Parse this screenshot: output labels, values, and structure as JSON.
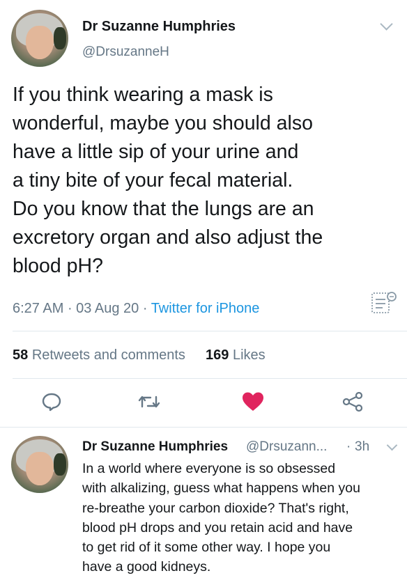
{
  "tweet": {
    "author_name": "Dr Suzanne Humphries",
    "author_handle": "@DrsuzanneH",
    "text": "If you think wearing a mask is\nwonderful, maybe you should also\nhave a little sip of your urine and\na tiny bite of your fecal material.\nDo you know that the lungs are an\nexcretory organ and also adjust the\nblood pH?",
    "time": "6:27 AM",
    "date": "03 Aug 20",
    "source": "Twitter for iPhone",
    "retweets_count": "58",
    "retweets_label": "Retweets and comments",
    "likes_count": "169",
    "likes_label": "Likes",
    "liked": true
  },
  "reply": {
    "author_name": "Dr Suzanne Humphries",
    "author_handle": "@Drsuzann...",
    "age": "3h",
    "text": "In a world where everyone is so obsessed\nwith alkalizing, guess what happens when you\nre-breathe your carbon dioxide? That's right,\nblood pH drops and you retain acid and have\nto get rid of it some other way. I hope you\nhave a good kidneys."
  },
  "icons": {
    "reply": "reply-icon",
    "retweet": "retweet-icon",
    "like": "heart-icon",
    "share": "share-icon",
    "translate": "translate-icon",
    "menu": "chevron-down-icon"
  },
  "colors": {
    "text": "#14171a",
    "secondary": "#657786",
    "link": "#1b95e0",
    "like": "#e0245e",
    "divider": "#e1e8ed"
  }
}
